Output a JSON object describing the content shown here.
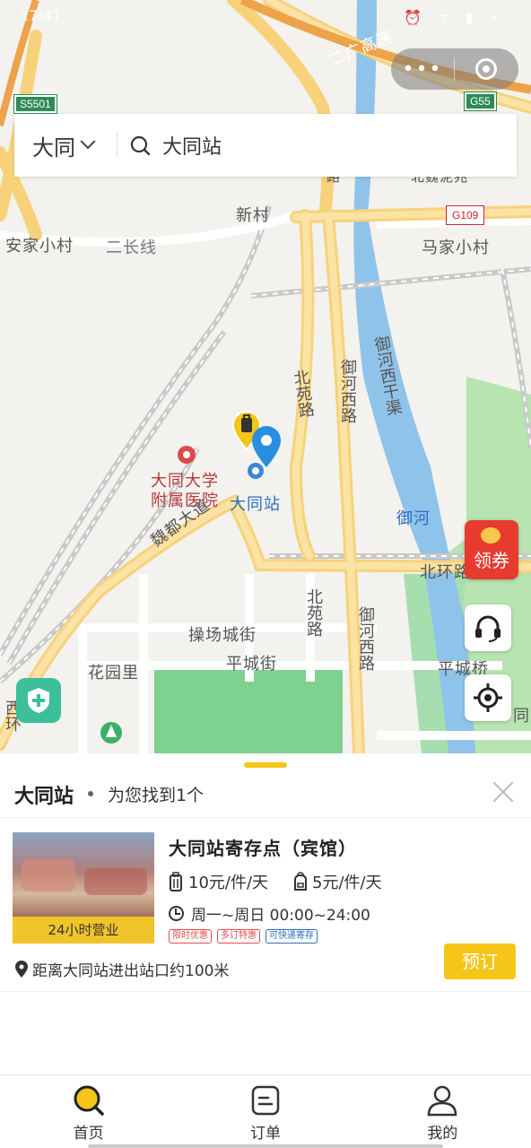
{
  "status_bar": {
    "time": "17:41",
    "icons": "⏰ ᯤ ▮ ⚡"
  },
  "capsule": {
    "more_label": "•••"
  },
  "search": {
    "city": "大同",
    "query": "大同站"
  },
  "map": {
    "labels": {
      "road_expressway": "二广高速",
      "shield_s5501": "S5501",
      "shield_g55": "G55",
      "shield_g109": "G109",
      "xincun": "新村",
      "anjia": "安家小村",
      "erchang": "二长线",
      "majia": "马家小村",
      "beiyuan1": "北苑路",
      "yuhexi1": "御河西路",
      "yuhexiganqu": "御河西干渠",
      "hospital": "大同大学附属医院",
      "station": "大同站",
      "weidu": "魏都大道",
      "yuhe": "御河",
      "beihuan": "北环路",
      "beiyuan2": "北苑路",
      "yuhexi2": "御河西路",
      "caochang": "操场城街",
      "pingcheng": "平城街",
      "huayuanli": "花园里",
      "pingchengqiao": "平城桥",
      "xihuan": "西环",
      "tong": "同",
      "beiwei": "北魏泥兆",
      "lu_top": "路"
    },
    "coupon_label": "领券"
  },
  "sheet": {
    "title": "大同站",
    "count_text": "为您找到1个",
    "result": {
      "name": "大同站寄存点（宾馆）",
      "hours_badge": "24小时营业",
      "price_large": "10元/件/天",
      "price_small": "5元/件/天",
      "hours": "周一~周日 00:00~24:00",
      "tags": [
        "限时优惠",
        "多订特惠",
        "可快递寄存"
      ],
      "book_label": "预订",
      "distance": "距离大同站进出站口约100米"
    }
  },
  "tabs": [
    {
      "label": "首页",
      "icon": "search-icon"
    },
    {
      "label": "订单",
      "icon": "order-icon"
    },
    {
      "label": "我的",
      "icon": "profile-icon"
    }
  ],
  "colors": {
    "accent": "#f5c518",
    "coupon": "#e63b2e",
    "river": "#8fc3ea",
    "park": "#6ad08a"
  }
}
